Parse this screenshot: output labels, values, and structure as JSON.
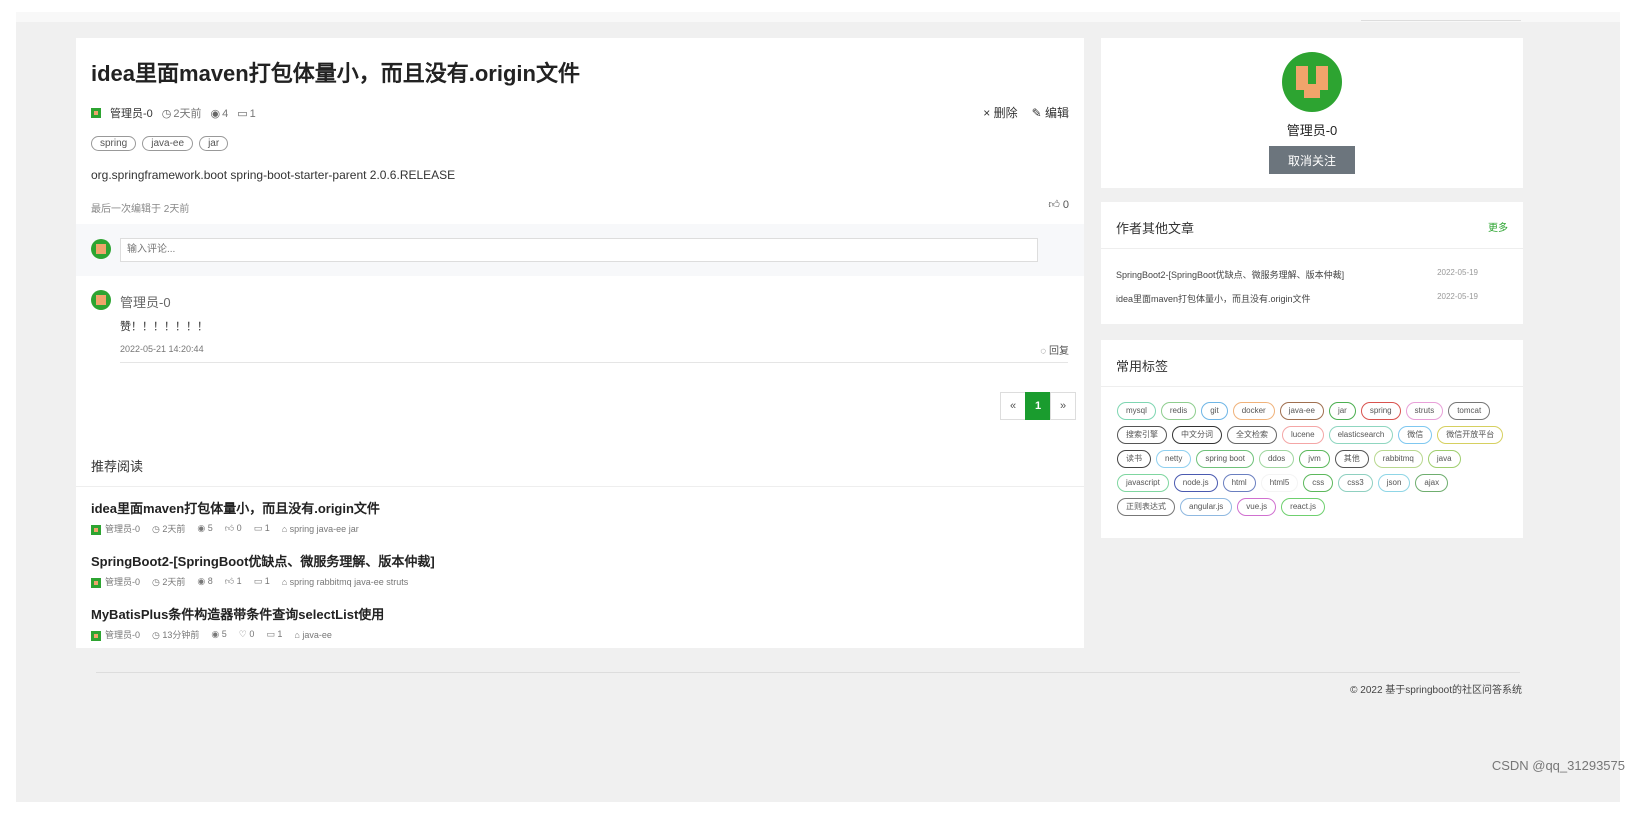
{
  "article": {
    "title": "idea里面maven打包体量小，而且没有.origin文件",
    "author": "管理员-0",
    "time": "2天前",
    "views": "4",
    "comments": "1",
    "delete_label": "删除",
    "edit_label": "编辑",
    "tags": [
      "spring",
      "java-ee",
      "jar"
    ],
    "content": "org.springframework.boot spring-boot-starter-parent 2.0.6.RELEASE",
    "last_edited": "最后一次编辑于 2天前",
    "likes": "0"
  },
  "comment_form": {
    "placeholder": "输入评论..."
  },
  "comment": {
    "author": "管理员-0",
    "text": "赞！！！！！！！",
    "time": "2022-05-21 14:20:44",
    "reply_label": "回复"
  },
  "pagination": {
    "prev": "«",
    "current": "1",
    "next": "»"
  },
  "recommend": {
    "title": "推荐阅读",
    "items": [
      {
        "title": "idea里面maven打包体量小，而且没有.origin文件",
        "author": "管理员-0",
        "time": "2天前",
        "views": "5",
        "likes": "0",
        "comments": "1",
        "tags": "spring java-ee jar"
      },
      {
        "title": "SpringBoot2-[SpringBoot优缺点、微服务理解、版本仲裁]",
        "author": "管理员-0",
        "time": "2天前",
        "views": "8",
        "likes": "1",
        "comments": "1",
        "tags": "spring rabbitmq java-ee struts"
      },
      {
        "title": "MyBatisPlus条件构造器带条件查询selectList使用",
        "author": "管理员-0",
        "time": "13分钟前",
        "views": "5",
        "likes": "0",
        "comments": "1",
        "tags": "java-ee"
      }
    ]
  },
  "profile": {
    "name": "管理员-0",
    "unfollow_label": "取消关注"
  },
  "others": {
    "title": "作者其他文章",
    "more": "更多",
    "items": [
      {
        "title": "SpringBoot2-[SpringBoot优缺点、微服务理解、版本仲裁]",
        "date": "2022-05-19"
      },
      {
        "title": "idea里面maven打包体量小，而且没有.origin文件",
        "date": "2022-05-19"
      }
    ]
  },
  "tagcloud": {
    "title": "常用标签",
    "tags": [
      {
        "label": "mysql",
        "color": "#7fd6b2"
      },
      {
        "label": "redis",
        "color": "#8fce8f"
      },
      {
        "label": "git",
        "color": "#6fb6e6"
      },
      {
        "label": "docker",
        "color": "#f0b27a"
      },
      {
        "label": "java-ee",
        "color": "#a07050"
      },
      {
        "label": "jar",
        "color": "#4caf50"
      },
      {
        "label": "spring",
        "color": "#d9534f"
      },
      {
        "label": "struts",
        "color": "#e8a0d8"
      },
      {
        "label": "tomcat",
        "color": "#777777"
      },
      {
        "label": "搜索引擎",
        "color": "#555555"
      },
      {
        "label": "中文分词",
        "color": "#333333"
      },
      {
        "label": "全文检索",
        "color": "#666666"
      },
      {
        "label": "lucene",
        "color": "#f4a6a6"
      },
      {
        "label": "elasticsearch",
        "color": "#8fd6c0"
      },
      {
        "label": "微信",
        "color": "#7fc8f0"
      },
      {
        "label": "微信开放平台",
        "color": "#d6d060"
      },
      {
        "label": "读书",
        "color": "#444444"
      },
      {
        "label": "netty",
        "color": "#8fd0f0"
      },
      {
        "label": "spring boot",
        "color": "#6fc27a"
      },
      {
        "label": "ddos",
        "color": "#9fd69f"
      },
      {
        "label": "jvm",
        "color": "#5cb85c"
      },
      {
        "label": "其他",
        "color": "#555555"
      },
      {
        "label": "rabbitmq",
        "color": "#b8d88f"
      },
      {
        "label": "java",
        "color": "#9fce6f"
      },
      {
        "label": "javascript",
        "color": "#7fd6a0"
      },
      {
        "label": "node.js",
        "color": "#4a5ab0"
      },
      {
        "label": "html",
        "color": "#6a7fc0"
      },
      {
        "label": "html5",
        "color": "#ffffff"
      },
      {
        "label": "css",
        "color": "#5cb85c"
      },
      {
        "label": "css3",
        "color": "#8fd0c0"
      },
      {
        "label": "json",
        "color": "#8fd6e6"
      },
      {
        "label": "ajax",
        "color": "#6fae6f"
      },
      {
        "label": "正则表达式",
        "color": "#777777"
      },
      {
        "label": "angular.js",
        "color": "#8fb8e0"
      },
      {
        "label": "vue.js",
        "color": "#d070d0"
      },
      {
        "label": "react.js",
        "color": "#6fd06f"
      }
    ]
  },
  "footer": {
    "text": "© 2022 基于springboot的社区问答系统"
  },
  "watermark": "CSDN @qq_31293575"
}
